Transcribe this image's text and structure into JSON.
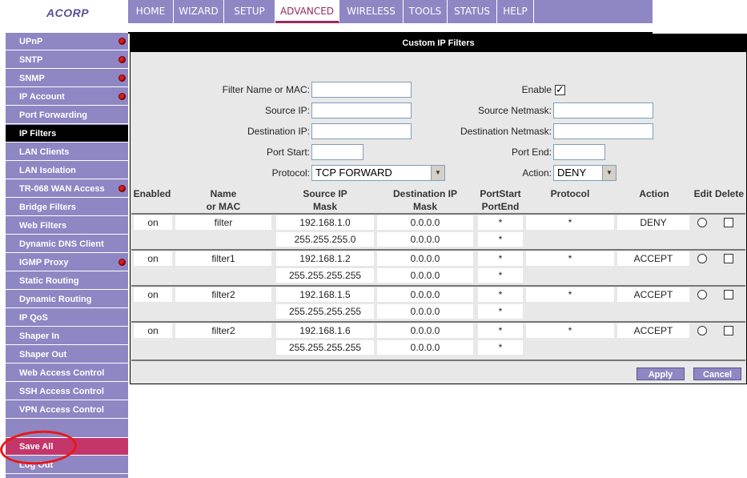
{
  "brand": {
    "logo_text": "ACORP"
  },
  "topnav": {
    "tabs": [
      "HOME",
      "WIZARD",
      "SETUP",
      "ADVANCED",
      "WIRELESS",
      "TOOLS",
      "STATUS",
      "HELP"
    ],
    "active": "ADVANCED"
  },
  "sidebar": {
    "items": [
      "UPnP",
      "SNTP",
      "SNMP",
      "IP Account",
      "Port Forwarding",
      "IP Filters",
      "LAN Clients",
      "LAN Isolation",
      "TR-068 WAN Access",
      "Bridge Filters",
      "Web Filters",
      "Dynamic DNS Client",
      "IGMP Proxy",
      "Static Routing",
      "Dynamic Routing",
      "IP QoS",
      "Shaper In",
      "Shaper Out",
      "Web Access Control",
      "SSH Access Control",
      "VPN Access Control"
    ],
    "active": "IP Filters",
    "save_all": "Save All",
    "log_out": "Log Out"
  },
  "panel": {
    "title": "Custom IP Filters",
    "form": {
      "filter_name_label": "Filter Name or MAC:",
      "enable_label": "Enable",
      "source_ip_label": "Source IP:",
      "source_netmask_label": "Source Netmask:",
      "dest_ip_label": "Destination IP:",
      "dest_netmask_label": "Destination Netmask:",
      "port_start_label": "Port Start:",
      "port_end_label": "Port End:",
      "protocol_label": "Protocol:",
      "protocol_value": "TCP FORWARD",
      "action_label": "Action:",
      "action_value": "DENY"
    },
    "table": {
      "headers": {
        "enabled": "Enabled",
        "name1": "Name",
        "name2": "or MAC",
        "src1": "Source IP",
        "src2": "Mask",
        "dst1": "Destination IP",
        "dst2": "Mask",
        "port1": "PortStart",
        "port2": "PortEnd",
        "protocol": "Protocol",
        "action": "Action",
        "edit": "Edit",
        "delete": "Delete"
      },
      "rows": [
        {
          "enabled": "on",
          "name": "filter",
          "src_ip": "192.168.1.0",
          "src_mask": "255.255.255.0",
          "dst_ip": "0.0.0.0",
          "dst_mask": "0.0.0.0",
          "port_start": "*",
          "port_end": "*",
          "protocol": "*",
          "action": "DENY"
        },
        {
          "enabled": "on",
          "name": "filter1",
          "src_ip": "192.168.1.2",
          "src_mask": "255.255.255.255",
          "dst_ip": "0.0.0.0",
          "dst_mask": "0.0.0.0",
          "port_start": "*",
          "port_end": "*",
          "protocol": "*",
          "action": "ACCEPT"
        },
        {
          "enabled": "on",
          "name": "filter2",
          "src_ip": "192.168.1.5",
          "src_mask": "255.255.255.255",
          "dst_ip": "0.0.0.0",
          "dst_mask": "0.0.0.0",
          "port_start": "*",
          "port_end": "*",
          "protocol": "*",
          "action": "ACCEPT"
        },
        {
          "enabled": "on",
          "name": "filter2",
          "src_ip": "192.168.1.6",
          "src_mask": "255.255.255.255",
          "dst_ip": "0.0.0.0",
          "dst_mask": "0.0.0.0",
          "port_start": "*",
          "port_end": "*",
          "protocol": "*",
          "action": "ACCEPT"
        }
      ]
    },
    "apply_label": "Apply",
    "cancel_label": "Cancel"
  },
  "colors": {
    "nav_bg": "#8f86c4",
    "active_tab_text": "#9b2a5e",
    "save_bg": "#c4366a",
    "annotation": "#e81818"
  }
}
